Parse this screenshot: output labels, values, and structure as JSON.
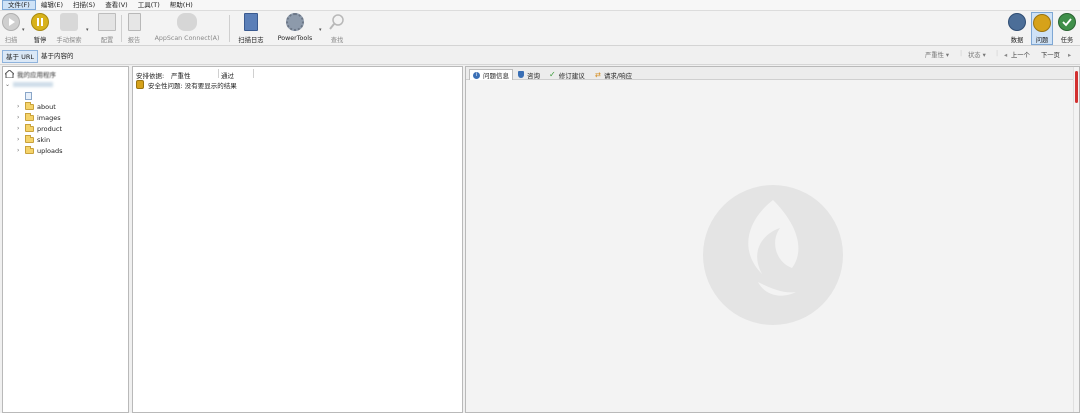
{
  "menu": [
    {
      "label": "文件(F)",
      "active": true
    },
    {
      "label": "编辑(E)"
    },
    {
      "label": "扫描(S)"
    },
    {
      "label": "查看(V)"
    },
    {
      "label": "工具(T)"
    },
    {
      "label": "帮助(H)"
    }
  ],
  "toolbar": {
    "scan": "扫描",
    "pause": "暂停",
    "manual_explore": "手动探索",
    "config": "配置",
    "report": "报告",
    "appscan_connect": "AppScan Connect(A)",
    "scan_log": "扫描日志",
    "powertools": "PowerTools",
    "find": "查找",
    "data": "数据",
    "issues": "问题",
    "tasks": "任务"
  },
  "filters": {
    "by_url": "基于 URL",
    "by_content": "基于内容的",
    "severity": "严重性 ▾",
    "status": "状态 ▾",
    "prev": "上一个",
    "next": "下一页"
  },
  "tree": {
    "root": "我的应用程序",
    "folders": [
      "about",
      "images",
      "product",
      "skin",
      "uploads"
    ]
  },
  "issues_panel": {
    "sort_by": "安排依据:",
    "col_severity": "严重性",
    "col_pass": "通过",
    "message": "安全性问题: 没有要显示的结果"
  },
  "detail_tabs": [
    "问题信息",
    "咨询",
    "修订建议",
    "请求/响应"
  ],
  "colors": {
    "accent": "#3a8ad8",
    "pause_yellow": "#d8b21a",
    "scroll_red": "#d23030"
  }
}
